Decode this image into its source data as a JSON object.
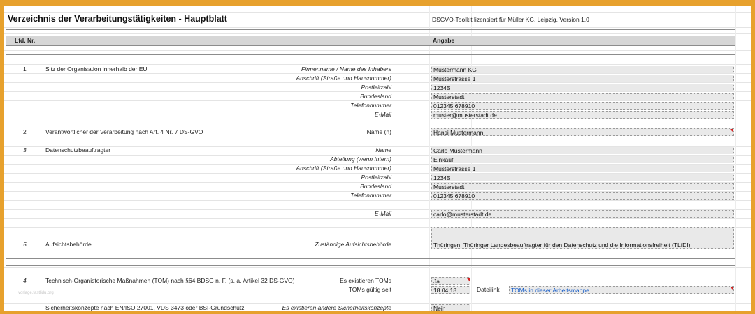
{
  "header": {
    "title": "Verzeichnis der Verarbeitungstätigkeiten - Hauptblatt",
    "license": "DSGVO-Toolkit lizensiert für  Müller KG, Leipzig, Version 1.0"
  },
  "columns": {
    "lfd": "Lfd. Nr.",
    "angabe": "Angabe"
  },
  "sections": {
    "s1": {
      "num": "1",
      "desc": "Sitz der Organisation innerhalb der EU",
      "fields": [
        {
          "label": "Firmenname / Name des Inhabers",
          "value": "Mustermann KG"
        },
        {
          "label": "Anschrift (Straße und Hausnummer)",
          "value": "Musterstrasse 1"
        },
        {
          "label": "Postleitzahl",
          "value": "12345"
        },
        {
          "label": "Bundesland",
          "value": "Musterstadt"
        },
        {
          "label": "Telefonnummer",
          "value": "012345 678910"
        },
        {
          "label": "E-Mail",
          "value": "muster@musterstadt.de"
        }
      ]
    },
    "s2": {
      "num": "2",
      "desc": "Verantwortlicher der Verarbeitung nach Art. 4 Nr. 7 DS-GVO",
      "label": "Name (n)",
      "value": "Hansi Mustermann"
    },
    "s3": {
      "num": "3",
      "desc": "Datenschutzbeauftragter",
      "fields": [
        {
          "label": "Name",
          "value": "Carlo Mustermann"
        },
        {
          "label": "Abteilung (wenn Intern)",
          "value": "Einkauf"
        },
        {
          "label": "Anschrift (Straße und Hausnummer)",
          "value": "Musterstrasse 1"
        },
        {
          "label": "Postleitzahl",
          "value": "12345"
        },
        {
          "label": "Bundesland",
          "value": "Musterstadt"
        },
        {
          "label": "Telefonnummer",
          "value": "012345 678910"
        }
      ],
      "email_label": "E-Mail",
      "email_value": "carlo@musterstadt.de"
    },
    "s5": {
      "num": "5",
      "desc": "Aufsichtsbehörde",
      "label": "Zuständige Aufsichtsbehörde",
      "value": "Thüringen: Thüringer Landesbeauftragter für den Datenschutz und die Informationsfreiheit (TLfDI)"
    },
    "s4": {
      "num": "4",
      "desc": "Technisch-Organistorische Maßnahmen (TOM) nach §64 BDSG n. F. (s. a. Artikel 32 DS-GVO)",
      "label1": "Es existieren TOMs",
      "value1": "Ja",
      "label2": "TOMs gültig seit",
      "value2": "18.04.18",
      "dateilink_label": "Dateilink",
      "dateilink_value": "TOMs in dieser Arbeitsmappe"
    },
    "s6": {
      "desc": "Sicherheitskonzepte nach EN/ISO 27001, VDS 3473 oder BSI-Grundschutz",
      "label": "Es existieren andere Sicherheitskonzepte",
      "value": "Nein"
    }
  },
  "watermark": "vorlage.fastlidu.org"
}
